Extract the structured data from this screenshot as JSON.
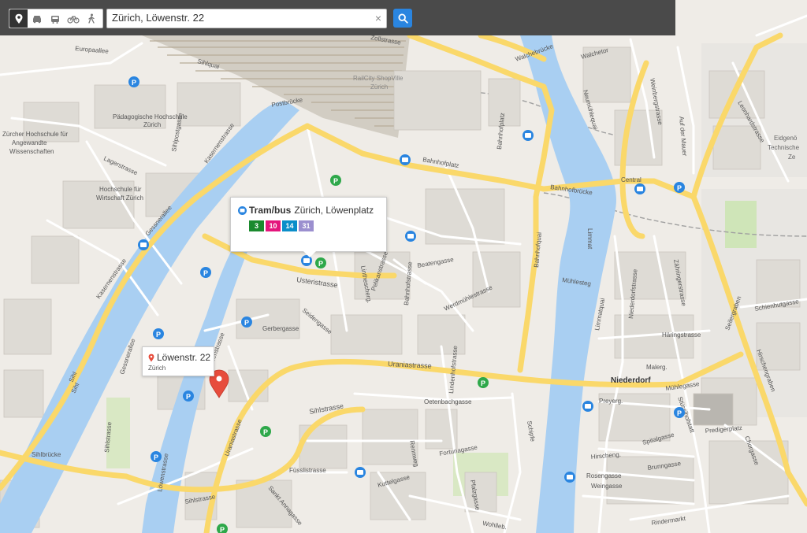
{
  "toolbar": {
    "modes": [
      {
        "name": "pin",
        "icon": "map-pin-icon",
        "active": true
      },
      {
        "name": "car",
        "icon": "car-icon",
        "active": false
      },
      {
        "name": "public-transport",
        "icon": "tram-icon",
        "active": false
      },
      {
        "name": "bicycle",
        "icon": "bicycle-icon",
        "active": false
      },
      {
        "name": "walk",
        "icon": "pedestrian-icon",
        "active": false
      }
    ],
    "search_value": "Zürich, Löwenstr. 22",
    "clear_icon": "close-icon",
    "search_icon": "search-icon",
    "accent": "#2a85e0"
  },
  "popup": {
    "kind": "Tram/bus",
    "name": "Zürich, Löwenplatz",
    "lines": [
      {
        "label": "3",
        "color": "#1b8a2e"
      },
      {
        "label": "10",
        "color": "#e4157c"
      },
      {
        "label": "14",
        "color": "#0b8ec9"
      },
      {
        "label": "31",
        "color": "#9b8fcf"
      }
    ]
  },
  "location": {
    "street": "Löwenstr. 22",
    "city": "Zürich",
    "marker_color": "#e74c3c"
  },
  "map_labels": [
    {
      "text": "Europaallee"
    },
    {
      "text": "Lagerstrasse"
    },
    {
      "text": "Pädagogische Hochschule"
    },
    {
      "text": "Zürich"
    },
    {
      "text": "Zürcher Hochschule für"
    },
    {
      "text": "Angewandte"
    },
    {
      "text": "Wissenschaften"
    },
    {
      "text": "Hochschule für"
    },
    {
      "text": "Wirtschaft Zürich"
    },
    {
      "text": "Postbrücke"
    },
    {
      "text": "Kasernenstrasse"
    },
    {
      "text": "RailCity ShopVille"
    },
    {
      "text": "Zürich"
    },
    {
      "text": "Bahnhofplatz"
    },
    {
      "text": "Bahnhofbrücke"
    },
    {
      "text": "Central"
    },
    {
      "text": "Walchebrücke"
    },
    {
      "text": "Neumühlequai"
    },
    {
      "text": "Limmat"
    },
    {
      "text": "Mühlesteg"
    },
    {
      "text": "Uraniastrasse"
    },
    {
      "text": "Niederdorf"
    },
    {
      "text": "Usteristrasse"
    },
    {
      "text": "Beatengasse"
    },
    {
      "text": "Werdmühlestrasse"
    },
    {
      "text": "Gerbergasse"
    },
    {
      "text": "Sihlstrasse"
    },
    {
      "text": "Sihlbrücke"
    },
    {
      "text": "Füsslistrasse"
    },
    {
      "text": "Fortunagasse"
    },
    {
      "text": "Kuttelgasse"
    },
    {
      "text": "Oetenbachgasse"
    },
    {
      "text": "Bahnhofquai"
    },
    {
      "text": "Limmatquai"
    },
    {
      "text": "Häringstrasse"
    },
    {
      "text": "Mühlegasse"
    },
    {
      "text": "Predigerplatz"
    },
    {
      "text": "Seilergraben"
    },
    {
      "text": "Weinbergstrasse"
    },
    {
      "text": "Leonhardstrasse"
    },
    {
      "text": "Eidgenö"
    },
    {
      "text": "Technische"
    },
    {
      "text": "Ze"
    },
    {
      "text": "Hirschengraben"
    },
    {
      "text": "Spitalgasse"
    },
    {
      "text": "Rosengasse"
    },
    {
      "text": "Brunngasse"
    },
    {
      "text": "Weingasse"
    },
    {
      "text": "Rindermarkt"
    },
    {
      "text": "Malerg."
    },
    {
      "text": "Preyerg."
    },
    {
      "text": "Zähringerstrasse"
    },
    {
      "text": "Niederdorfstrasse"
    },
    {
      "text": "Sihl"
    },
    {
      "text": "Gessnerallee"
    },
    {
      "text": "Schipfe"
    },
    {
      "text": "Lindenhofstrasse"
    },
    {
      "text": "Löwenstrasse"
    },
    {
      "text": "Bahnhofstrasse"
    },
    {
      "text": "Pelikanstrasse"
    },
    {
      "text": "Sankt Annagasse"
    },
    {
      "text": "Hirscheng."
    },
    {
      "text": "Chorgasse"
    },
    {
      "text": "Schienhutgasse"
    },
    {
      "text": "Auf der Mauer"
    },
    {
      "text": "Walchetor"
    },
    {
      "text": "Seidengasse"
    },
    {
      "text": "Rennweg"
    },
    {
      "text": "Pfalzgasse"
    },
    {
      "text": "Sihlquai"
    },
    {
      "text": "Sihlpostgasse"
    },
    {
      "text": "Kasernenstrasse"
    },
    {
      "text": "Zollstrasse"
    },
    {
      "text": "Linthescherg."
    },
    {
      "text": "Bahnhofplatz"
    },
    {
      "text": "Wohlleb."
    },
    {
      "text": "Sihlstrasse"
    },
    {
      "text": "Sihlstrasse"
    },
    {
      "text": "Löwenstrasse"
    },
    {
      "text": "Uraniastrasse"
    },
    {
      "text": "Sihl"
    },
    {
      "text": "Gessnerallee"
    },
    {
      "text": "Stüssihofstatt"
    }
  ]
}
